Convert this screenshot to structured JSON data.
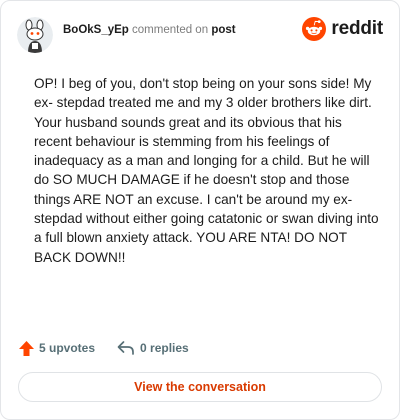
{
  "header": {
    "username": "BoOkS_yEp",
    "action_text": "commented on",
    "post_link": "post",
    "brand_name": "reddit"
  },
  "comment": {
    "text": "OP! I beg of you, don't stop being on your sons side! My ex- stepdad treated me and my 3 older brothers like dirt. Your husband sounds great and its obvious that his recent behaviour is stemming from his feelings of inadequacy as a man and longing for a child. But he will do SO MUCH DAMAGE if he doesn't stop and those things ARE NOT an excuse. I can't be around my ex-stepdad without either going catatonic or swan diving into a full blown anxiety attack. YOU ARE NTA! DO NOT BACK DOWN!!"
  },
  "footer": {
    "upvotes": "5 upvotes",
    "replies": "0 replies"
  },
  "cta": {
    "label": "View the conversation"
  },
  "colors": {
    "brand": "#ff4500",
    "upvote": "#ff4500",
    "cta_text": "#d93a00",
    "muted": "#576f76"
  },
  "icons": [
    "snoo-avatar-icon",
    "reddit-logo-icon",
    "upvote-arrow-icon",
    "reply-arrow-icon"
  ]
}
